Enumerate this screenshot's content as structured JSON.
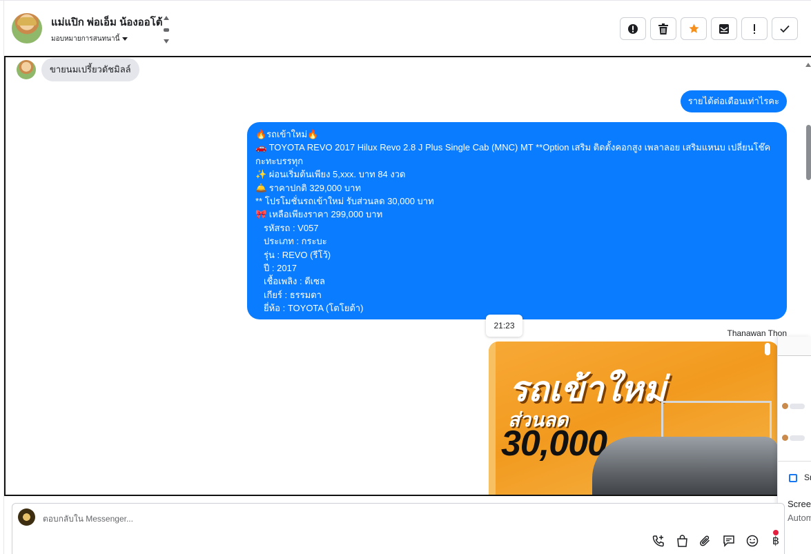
{
  "header": {
    "contact_name": "แม่แปิก พ่อเอ็ม น้องออโต้",
    "assign_label": "มอบหมายการสนทนานี้",
    "toolbar": [
      {
        "name": "mark-spam-button",
        "icon": "alert-circle-icon",
        "glyph": "!"
      },
      {
        "name": "delete-button",
        "icon": "trash-icon",
        "glyph": ""
      },
      {
        "name": "star-button",
        "icon": "star-icon",
        "glyph": "★"
      },
      {
        "name": "archive-button",
        "icon": "mail-archive-icon",
        "glyph": ""
      },
      {
        "name": "follow-up-button",
        "icon": "exclamation-icon",
        "glyph": "!"
      },
      {
        "name": "mark-done-button",
        "icon": "check-icon",
        "glyph": "✓"
      }
    ]
  },
  "messages": {
    "incoming": "ขายนมเปรี้ยวดัชมิลล์",
    "outgoing_1": "รายได้ต่อเดือนเท่าไรคะ",
    "outgoing_2": {
      "lines": [
        "🔥รถเข้าใหม่🔥",
        "🚗 TOYOTA REVO 2017 Hilux Revo 2.8 J Plus Single Cab (MNC) MT **Option เสริม ติดตั้งคอกสูง เพลาลอย เสริมแหนบ เปลี่ยนโช๊ค กะทะบรรทุก",
        "✨  ผ่อนเริ่มต้นเพียง 5,xxx. บาท 84 งวด",
        "🛎️   ราคาปกติ 329,000 บาท",
        "** โปรโมชั่นรถเข้าใหม่ รับส่วนลด 30,000 บาท",
        "🎀  เหลือเพียงราคา 299,000 บาท"
      ],
      "details": [
        "รหัสรถ : V057",
        "ประเภท : กระบะ",
        "รุ่น : REVO (รีโว้)",
        "ปี : 2017",
        "เชื้อเพลิง : ดีเซล",
        "เกียร์ : ธรรมดา",
        "ยี่ห้อ : TOYOTA (โตโยต้า)"
      ]
    },
    "timestamp": "21:23",
    "sender_name": "Thanawan Thon",
    "image": {
      "headline": "รถเข้าใหม่",
      "sub": "ส่วนลด",
      "amount": "30,000.-"
    }
  },
  "side_panel": {
    "title_fragment": "Sn",
    "line1": "Scree",
    "line2": "Autom"
  },
  "composer": {
    "placeholder": "ตอบกลับใน Messenger...",
    "icons": [
      "phone-add-icon",
      "shopping-bag-icon",
      "paperclip-icon",
      "saved-reply-icon",
      "emoji-icon",
      "baht-icon"
    ]
  },
  "colors": {
    "messenger_blue": "#0a7cff",
    "incoming_gray": "#e4e6eb",
    "star_orange": "#f5901e",
    "notification_red": "#e41e3f"
  }
}
